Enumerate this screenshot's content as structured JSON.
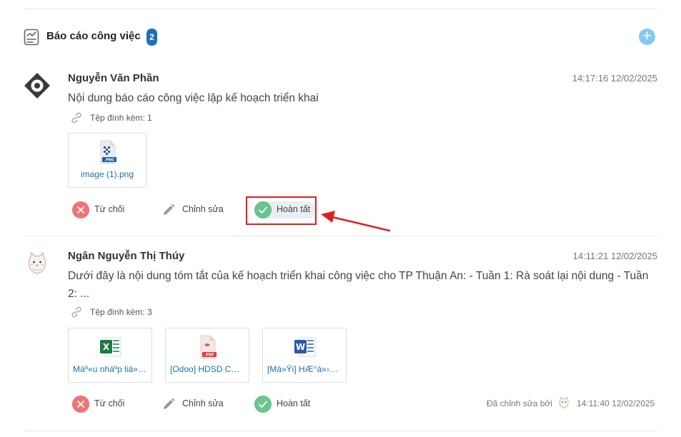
{
  "section": {
    "title": "Báo cáo công việc",
    "count": "2",
    "icon": "report-chart-icon",
    "add_icon": "plus-icon"
  },
  "reports": [
    {
      "author": "Nguyễn Văn Phần",
      "timestamp": "14:17:16 12/02/2025",
      "content": "Nội dung báo cáo công việc lập kế hoạch triển khai",
      "attachments_label": "Tệp đính kèm: 1",
      "attachments": [
        {
          "name": "image (1).png",
          "type": "png"
        }
      ],
      "actions": {
        "reject": "Từ chối",
        "edit": "Chỉnh sửa",
        "complete": "Hoàn tất"
      }
    },
    {
      "author": "Ngân Nguyễn Thị Thúy",
      "timestamp": "14:11:21 12/02/2025",
      "content": "Dưới đây là nội dung tóm tắt của kế hoạch triển khai công việc cho TP Thuận An: - Tuần 1: Rà soát lại nội dung - Tuần 2: ...",
      "attachments_label": "Tệp đính kèm: 3",
      "attachments": [
        {
          "name": "Máº«u nháº­p liá»‡u",
          "type": "excel"
        },
        {
          "name": "[Odoo] HDSD CHUNG",
          "type": "pdf"
        },
        {
          "name": "[Má»Ÿi] HÆ°á»›ng dẫn",
          "type": "word"
        }
      ],
      "actions": {
        "reject": "Từ chối",
        "edit": "Chỉnh sửa",
        "complete": "Hoàn tất"
      },
      "edited_by_label": "Đã chỉnh sửa bởi",
      "edited_at": "14:11:40 12/02/2025"
    }
  ],
  "colors": {
    "badge": "#1e6fb8",
    "add_button": "#85c9f1",
    "reject": "#f07476",
    "complete": "#69c48e",
    "link": "#1f6fb2",
    "annotation": "#e21f1f"
  }
}
